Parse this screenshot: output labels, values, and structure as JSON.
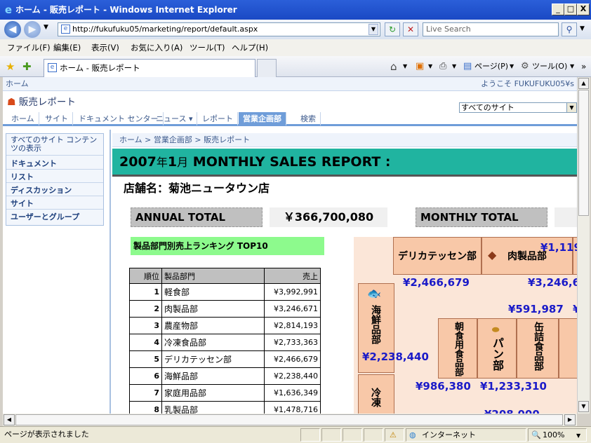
{
  "window": {
    "title": "ホーム - 販売レポート - Windows Internet Explorer",
    "min": "_",
    "max": "□",
    "close": "X"
  },
  "address": {
    "url": "http://fukufuku05/marketing/report/default.aspx",
    "search_placeholder": "Live Search"
  },
  "menu": [
    "ファイル(F)",
    "編集(E)",
    "表示(V)",
    "お気に入り(A)",
    "ツール(T)",
    "ヘルプ(H)"
  ],
  "tab": {
    "label": "ホーム - 販売レポート"
  },
  "toolbar": {
    "page": "ページ(P)",
    "tools": "ツール(O)"
  },
  "sp": {
    "top_left": "ホーム",
    "welcome": "ようこそ FUKUFUKU05¥s",
    "site_title": "販売レポート",
    "scope": "すべてのサイト",
    "nav": [
      "ホーム",
      "サイト",
      "ドキュメント センター",
      "ニュース ▾",
      "レポート",
      "営業企画部",
      "検索"
    ],
    "quick": [
      "すべてのサイト コンテンツの表示",
      "ドキュメント",
      "リスト",
      "ディスカッション",
      "サイト",
      "ユーザーとグループ"
    ],
    "breadcrumb": "ホーム > 営業企画部 > 販売レポート"
  },
  "report": {
    "head_year": "2007",
    "head_y": "年",
    "head_month": "1",
    "head_m": "月",
    "head_title": "MONTHLY SALES REPORT :",
    "store": "店舗名：菊池ニュータウン店",
    "annual_label": "ANNUAL TOTAL",
    "annual_value": "￥366,700,080",
    "monthly_label": "MONTHLY TOTAL",
    "ranking_title": "製品部門別売上ランキング TOP10",
    "table_headers": [
      "順位",
      "製品部門",
      "売上"
    ],
    "rows": [
      {
        "rank": "1",
        "dept": "軽食部",
        "sales": "¥3,992,991"
      },
      {
        "rank": "2",
        "dept": "肉製品部",
        "sales": "¥3,246,671"
      },
      {
        "rank": "3",
        "dept": "農産物部",
        "sales": "¥2,814,193"
      },
      {
        "rank": "4",
        "dept": "冷凍食品部",
        "sales": "¥2,733,363"
      },
      {
        "rank": "5",
        "dept": "デリカテッセン部",
        "sales": "¥2,466,679"
      },
      {
        "rank": "6",
        "dept": "海鮮品部",
        "sales": "¥2,238,440"
      },
      {
        "rank": "7",
        "dept": "家庭用品部",
        "sales": "¥1,636,349"
      },
      {
        "rank": "8",
        "dept": "乳製品部",
        "sales": "¥1,478,716"
      }
    ]
  },
  "map": {
    "deli": "デリカテッセン部",
    "meat": "肉製品部",
    "seafood": "海鮮品部",
    "breakfast": "朝食用食品部",
    "bread": "パン部",
    "canned": "缶詰食品部",
    "frozen": "冷凍",
    "v_1119": "¥1,119",
    "v_deli": "¥2,466,679",
    "v_meat": "¥3,246,6",
    "v_591": "¥591,987",
    "v_sea": "¥2,238,440",
    "v_986": "¥986,380",
    "v_bread": "¥1,233,310",
    "v_208": "¥208,000"
  },
  "status": {
    "text": "ページが表示されました",
    "zone": "インターネット",
    "zoom": "100%"
  }
}
